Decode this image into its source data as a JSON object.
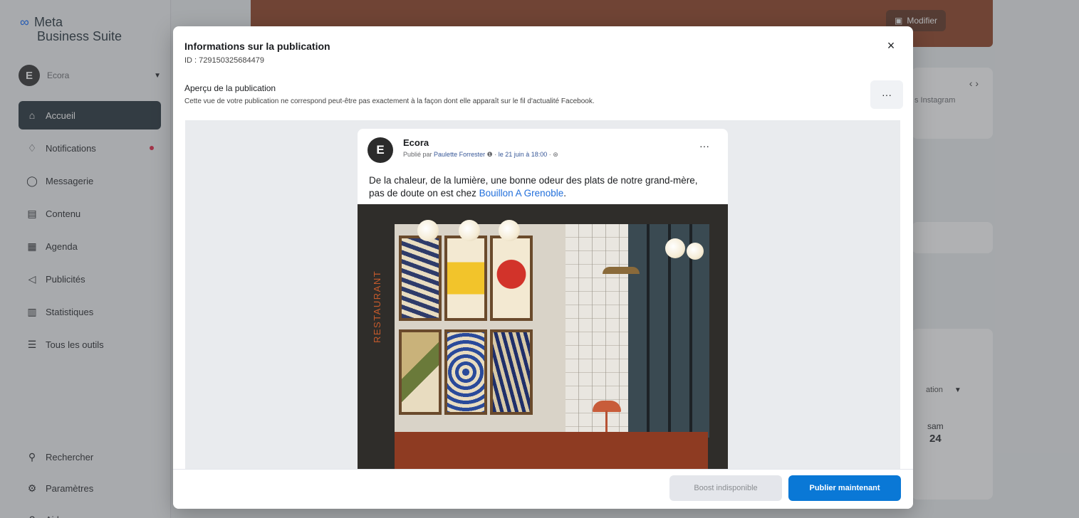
{
  "app": {
    "brand_logo": "∞",
    "brand_word": "Meta",
    "brand_suite": "Business Suite"
  },
  "account": {
    "initial": "E",
    "name": "Ecora"
  },
  "sidebar": {
    "items": [
      {
        "label": "Accueil",
        "icon": "home-icon",
        "glyph": "⌂",
        "active": true
      },
      {
        "label": "Notifications",
        "icon": "bell-icon",
        "glyph": "♢",
        "dot": true
      },
      {
        "label": "Messagerie",
        "icon": "chat-icon",
        "glyph": "◯"
      },
      {
        "label": "Contenu",
        "icon": "content-icon",
        "glyph": "▤"
      },
      {
        "label": "Agenda",
        "icon": "calendar-icon",
        "glyph": "▦"
      },
      {
        "label": "Publicités",
        "icon": "megaphone-icon",
        "glyph": "◁"
      },
      {
        "label": "Statistiques",
        "icon": "chart-icon",
        "glyph": "▥"
      },
      {
        "label": "Tous les outils",
        "icon": "menu-icon",
        "glyph": "☰"
      }
    ],
    "bottom": [
      {
        "label": "Rechercher",
        "icon": "search-icon",
        "glyph": "⚲"
      },
      {
        "label": "Paramètres",
        "icon": "gear-icon",
        "glyph": "⚙"
      },
      {
        "label": "Aide",
        "icon": "help-icon",
        "glyph": "?"
      }
    ]
  },
  "background": {
    "hero_button": "Modifier",
    "right_card_text": "s Instagram",
    "right_select": "ation",
    "day_name": "sam",
    "day_number": "24"
  },
  "modal": {
    "title": "Informations sur la publication",
    "id_line": "ID : 729150325684479",
    "preview_label": "Aperçu de la publication",
    "preview_note": "Cette vue de votre publication ne correspond peut-être pas exactement à la façon dont elle apparaît sur le fil d'actualité Facebook.",
    "close_glyph": "×",
    "more_glyph": "···",
    "boost_label": "Boost indisponible",
    "publish_label": "Publier maintenant"
  },
  "post": {
    "initial": "E",
    "page_name": "Ecora",
    "published_by_prefix": "Publié par",
    "author": "Paulette Forrester",
    "date": "le 21 juin à 18:00",
    "more_glyph": "···",
    "text_before": "De la chaleur, de la lumière, une bonne odeur des plats de notre grand-mère, pas de doute on est chez ",
    "text_link": "Bouillon A Grenoble",
    "text_after": ".",
    "image_vertical_text": "RESTAURANT"
  }
}
